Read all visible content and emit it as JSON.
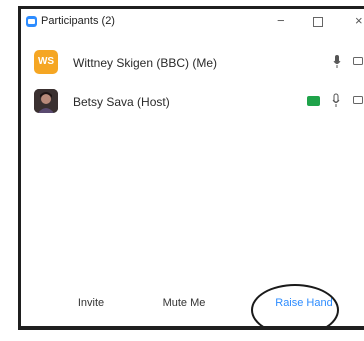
{
  "window": {
    "title": "Participants (2)",
    "minimize_glyph": "−",
    "close_glyph": "×",
    "icon": "zoom-app-icon"
  },
  "participants": [
    {
      "name": "Wittney Skigen (BBC) (Me)",
      "avatar_initials": "WS",
      "avatar_color": "#f5a623",
      "icons": [
        "mic-icon",
        "video-icon"
      ]
    },
    {
      "name": "Betsy Sava (Host)",
      "avatar_type": "photo",
      "icons": [
        "screen-share-icon",
        "mic-icon",
        "video-icon"
      ],
      "screen_share_color": "#1fa34a"
    }
  ],
  "footer": {
    "invite_label": "Invite",
    "mute_label": "Mute Me",
    "raise_hand_label": "Raise Hand",
    "raise_hand_color": "#2d8cff"
  }
}
